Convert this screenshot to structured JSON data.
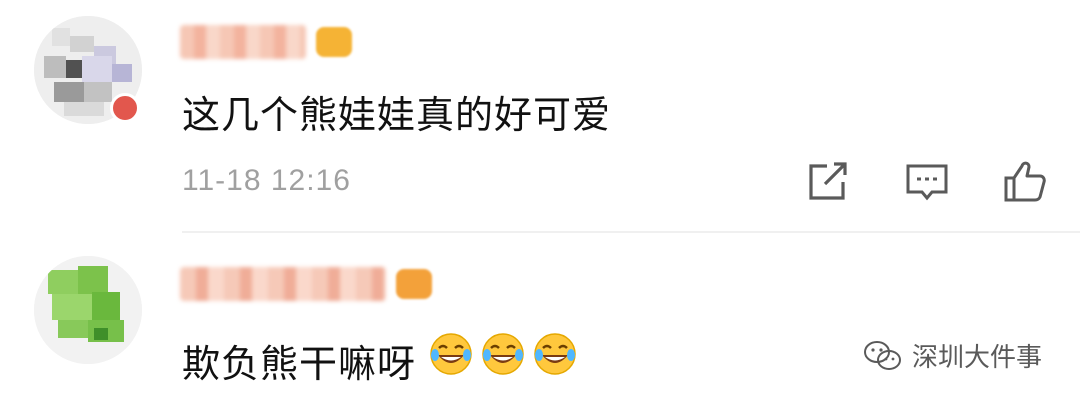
{
  "comments": [
    {
      "text": "这几个熊娃娃真的好可爱",
      "timestamp": "11-18 12:16",
      "avatar": "blurred-avatar",
      "badge_color": "#e2574d"
    },
    {
      "text": "欺负熊干嘛呀",
      "emojis": [
        "laughing-crying-emoji",
        "laughing-crying-emoji",
        "laughing-crying-emoji"
      ],
      "avatar": "blurred-avatar"
    }
  ],
  "actions": {
    "share_icon": "share-icon",
    "reply_icon": "comment-icon",
    "like_icon": "thumbs-up-icon"
  },
  "watermark": {
    "text": "深圳大件事",
    "icon": "wechat-icon"
  },
  "colors": {
    "text": "#111111",
    "meta": "#a0a0a0",
    "divider": "#f0f0f0",
    "icon": "#5a5a5a"
  }
}
